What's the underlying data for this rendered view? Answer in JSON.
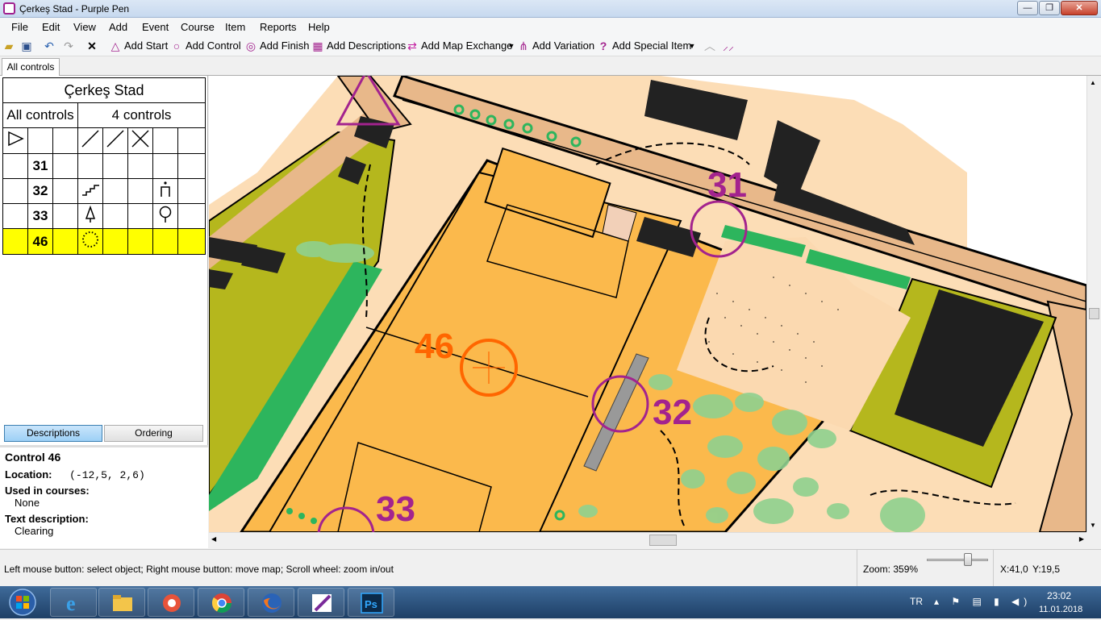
{
  "window": {
    "title": "Çerkeş Stad - Purple Pen",
    "min": "—",
    "max": "❐",
    "close": "✕"
  },
  "menu": [
    "File",
    "Edit",
    "View",
    "Add",
    "Event",
    "Course",
    "Item",
    "Reports",
    "Help"
  ],
  "toolbar": {
    "add_start": "Add Start",
    "add_control": "Add Control",
    "add_finish": "Add Finish",
    "add_descriptions": "Add Descriptions",
    "add_map_exchange": "Add Map Exchange",
    "add_variation": "Add Variation",
    "add_special_item": "Add Special Item"
  },
  "tab": "All controls",
  "description_sheet": {
    "title": "Çerkeş Stad",
    "course_name": "All controls",
    "course_info": "4 controls",
    "rows": [
      {
        "code": "31",
        "symbol": "",
        "extra": ""
      },
      {
        "code": "32",
        "symbol": "stairs",
        "extra": "person"
      },
      {
        "code": "33",
        "symbol": "tree",
        "extra": "bulb"
      },
      {
        "code": "46",
        "symbol": "clearing",
        "extra": "",
        "selected": true
      }
    ]
  },
  "panes": {
    "descriptions": "Descriptions",
    "ordering": "Ordering"
  },
  "info": {
    "heading": "Control 46",
    "location_label": "Location:",
    "location_value": "(-12,5, 2,6)",
    "used_label": "Used in courses:",
    "used_value": "None",
    "text_label": "Text description:",
    "text_value": "Clearing"
  },
  "map_labels": {
    "c31": "31",
    "c32": "32",
    "c33": "33",
    "c46": "46"
  },
  "colors": {
    "course": "#a3238e",
    "selected": "#ff6600",
    "highlight": "#ffff00"
  },
  "status": {
    "text": "Left mouse button: select object;   Right mouse button: move map;   Scroll wheel: zoom in/out",
    "zoom": "Zoom: 359%",
    "zoom_level": 359,
    "x": "X:41,0",
    "y": "Y:19,5"
  },
  "taskbar": {
    "lang": "TR",
    "time": "23:02",
    "date": "11.01.2018"
  }
}
